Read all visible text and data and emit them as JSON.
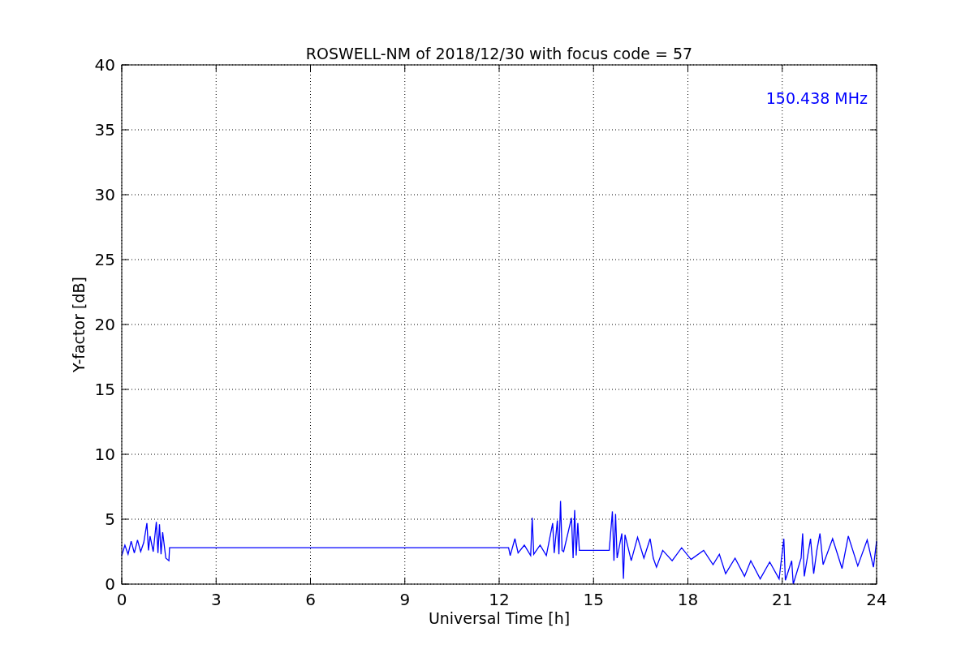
{
  "figure": {
    "chart_data": {
      "type": "line",
      "title": "ROSWELL-NM of 2018/12/30 with focus code = 57",
      "xlabel": "Universal Time [h]",
      "ylabel": "Y-factor [dB]",
      "x": [
        0,
        0.1,
        0.2,
        0.3,
        0.4,
        0.5,
        0.6,
        0.7,
        0.8,
        0.85,
        0.9,
        1.0,
        1.1,
        1.15,
        1.2,
        1.25,
        1.3,
        1.4,
        1.5,
        1.52,
        12.3,
        12.35,
        12.5,
        12.6,
        12.8,
        13.0,
        13.05,
        13.1,
        13.3,
        13.5,
        13.7,
        13.75,
        13.85,
        13.9,
        13.95,
        14.0,
        14.05,
        14.3,
        14.35,
        14.4,
        14.45,
        14.5,
        14.55,
        15.5,
        15.6,
        15.65,
        15.7,
        15.75,
        15.9,
        15.95,
        16.0,
        16.2,
        16.4,
        16.6,
        16.8,
        16.9,
        17.0,
        17.2,
        17.5,
        17.8,
        18.1,
        18.5,
        18.8,
        19.0,
        19.2,
        19.5,
        19.8,
        20.0,
        20.3,
        20.6,
        20.9,
        21.05,
        21.1,
        21.3,
        21.35,
        21.6,
        21.65,
        21.7,
        21.9,
        22.0,
        22.1,
        22.2,
        22.3,
        22.6,
        22.9,
        23.1,
        23.4,
        23.7,
        23.9,
        24.0
      ],
      "series": [
        {
          "name": "150.438 MHz",
          "color": "#0000ff",
          "values": [
            2.2,
            3.0,
            2.3,
            3.3,
            2.4,
            3.4,
            2.5,
            3.2,
            4.7,
            2.6,
            3.7,
            2.5,
            4.8,
            2.4,
            4.6,
            2.3,
            4.0,
            2.0,
            1.8,
            2.8,
            2.8,
            2.2,
            3.5,
            2.4,
            3.0,
            2.2,
            5.1,
            2.3,
            3.0,
            2.2,
            4.7,
            2.4,
            4.9,
            2.3,
            6.4,
            2.6,
            2.5,
            5.1,
            2.0,
            5.7,
            2.2,
            4.7,
            2.6,
            2.6,
            5.6,
            1.8,
            5.4,
            2.0,
            3.9,
            0.4,
            3.8,
            1.8,
            3.6,
            2.0,
            3.5,
            2.0,
            1.3,
            2.6,
            1.8,
            2.8,
            1.9,
            2.6,
            1.5,
            2.3,
            0.8,
            2.0,
            0.6,
            1.8,
            0.4,
            1.7,
            0.4,
            3.5,
            0.3,
            1.8,
            0.0,
            2.0,
            3.9,
            0.6,
            3.5,
            0.8,
            2.6,
            3.9,
            1.5,
            3.5,
            1.2,
            3.7,
            1.4,
            3.4,
            1.3,
            3.3
          ]
        }
      ],
      "xlim": [
        0,
        24
      ],
      "ylim": [
        0,
        40
      ],
      "xticks": [
        0,
        3,
        6,
        9,
        12,
        15,
        18,
        21,
        24
      ],
      "yticks": [
        0,
        5,
        10,
        15,
        20,
        25,
        30,
        35,
        40
      ],
      "grid": true
    }
  }
}
